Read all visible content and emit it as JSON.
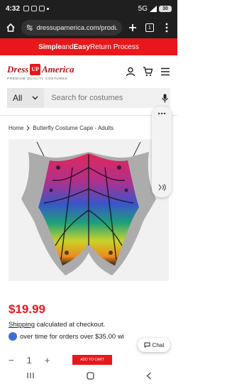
{
  "status_bar": {
    "time": "4:32",
    "network": "5G",
    "battery": "30"
  },
  "browser": {
    "url": "dressupamerica.com/produc",
    "tab_count": "1"
  },
  "promo": {
    "strong1": "Simple",
    "and": " and ",
    "strong2": "Easy",
    "rest": " Return Process"
  },
  "logo": {
    "left": "Dress",
    "mid": "UP",
    "right": "America",
    "tagline": "PREMIUM QUALITY COSTUMES"
  },
  "search": {
    "category": "All",
    "placeholder": "Search for costumes"
  },
  "breadcrumb": {
    "home": "Home",
    "current": "Butterfly Costume Cape - Adults"
  },
  "product": {
    "price": "$19.99",
    "shipping_link": "Shipping",
    "shipping_rest": " calculated at checkout.",
    "installment": "over time for orders over $35.00 wi"
  },
  "chat": {
    "label": "Chat"
  },
  "cart": {
    "minus": "−",
    "qty": "1",
    "plus": "+",
    "add_label": "ADD TO CART"
  },
  "colors": {
    "brand_red": "#e8171b",
    "chrome_dark": "#1f1f1f"
  }
}
